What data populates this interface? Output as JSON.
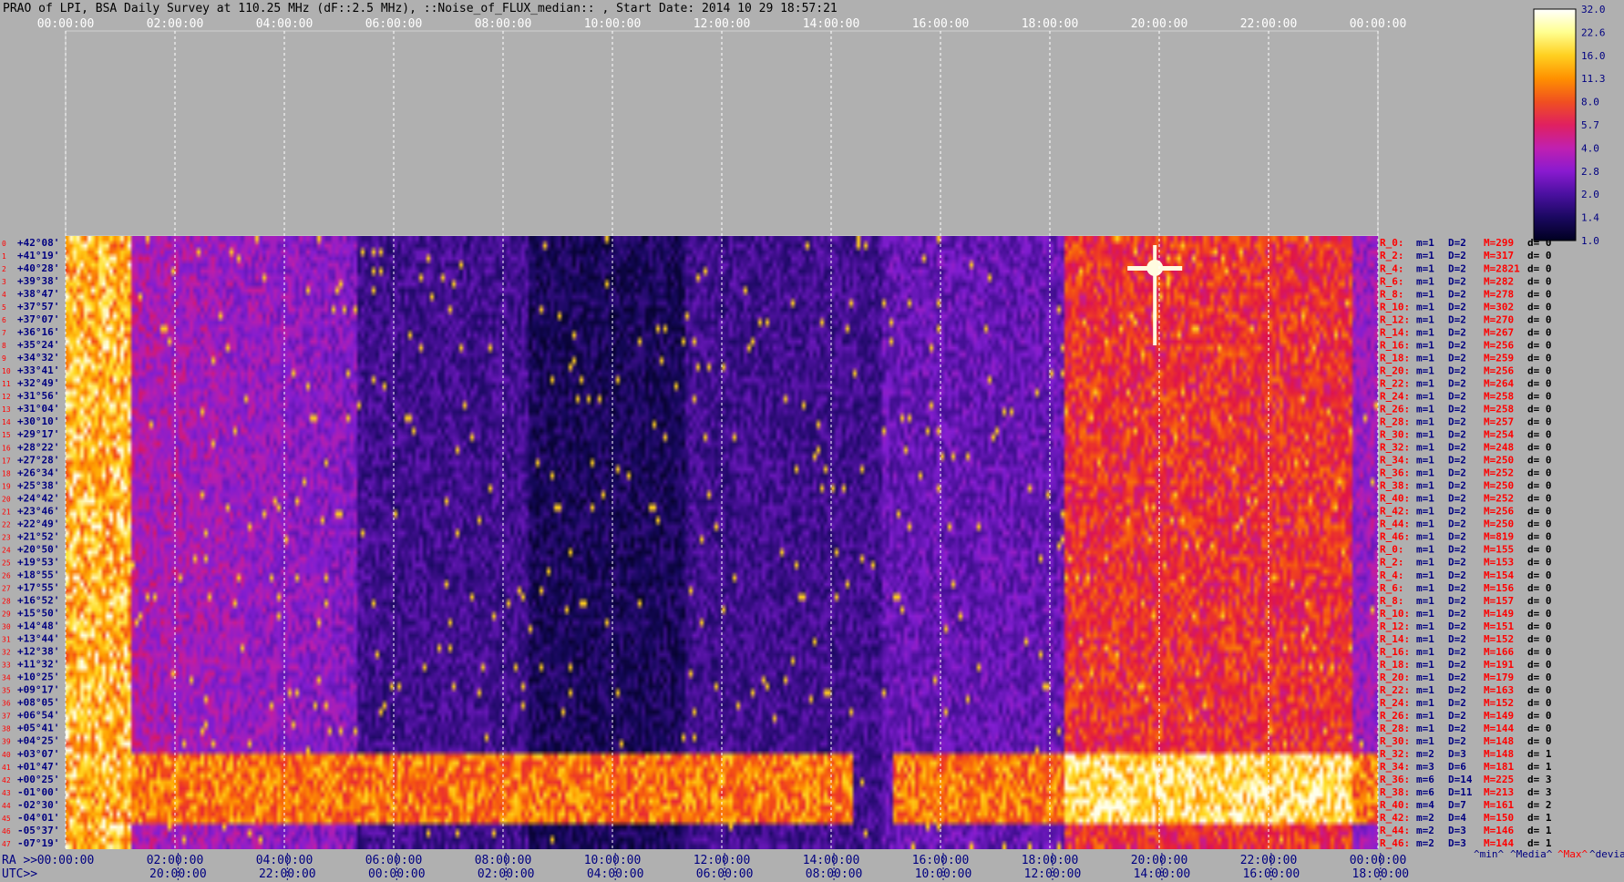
{
  "title": "PRAO of LPI, BSA Daily Survey at 110.25 MHz (dF::2.5 MHz), ::Noise_of_FLUX_median:: , Start Date: 2014 10 29 18:57:21",
  "chart_data": {
    "type": "heatmap",
    "top_axis_ticks": [
      "00:00:00",
      "02:00:00",
      "04:00:00",
      "06:00:00",
      "08:00:00",
      "10:00:00",
      "12:00:00",
      "14:00:00",
      "16:00:00",
      "18:00:00",
      "20:00:00",
      "22:00:00",
      "00:00:00"
    ],
    "ra_label": "RA >>",
    "ra_ticks": [
      "00:00:00",
      "02:00:00",
      "04:00:00",
      "06:00:00",
      "08:00:00",
      "10:00:00",
      "12:00:00",
      "14:00:00",
      "16:00:00",
      "18:00:00",
      "20:00:00",
      "22:00:00",
      "00:00:00"
    ],
    "utc_label": "UTC>>",
    "utc_ticks": [
      "20:00:00",
      "22:00:00",
      "00:00:00",
      "02:00:00",
      "04:00:00",
      "06:00:00",
      "08:00:00",
      "10:00:00",
      "12:00:00",
      "14:00:00",
      "16:00:00",
      "18:00:00"
    ],
    "declinations": [
      "+42°08'",
      "+41°19'",
      "+40°28'",
      "+39°38'",
      "+38°47'",
      "+37°57'",
      "+37°07'",
      "+36°16'",
      "+35°24'",
      "+34°32'",
      "+33°41'",
      "+32°49'",
      "+31°56'",
      "+31°04'",
      "+30°10'",
      "+29°17'",
      "+28°22'",
      "+27°28'",
      "+26°34'",
      "+25°38'",
      "+24°42'",
      "+23°46'",
      "+22°49'",
      "+21°52'",
      "+20°50'",
      "+19°53'",
      "+18°55'",
      "+17°55'",
      "+16°52'",
      "+15°50'",
      "+14°48'",
      "+13°44'",
      "+12°38'",
      "+11°32'",
      "+10°25'",
      "+09°17'",
      "+08°05'",
      "+06°54'",
      "+05°41'",
      "+04°25'",
      "+03°07'",
      "+01°47'",
      "+00°25'",
      "-01°00'",
      "-02°30'",
      "-04°01'",
      "-05°37'",
      "-07°19'"
    ],
    "row_numbers": [
      "0",
      "1",
      "2",
      "3",
      "4",
      "5",
      "6",
      "7",
      "8",
      "9",
      "10",
      "11",
      "12",
      "13",
      "14",
      "15",
      "16",
      "17",
      "18",
      "19",
      "20",
      "21",
      "22",
      "23",
      "24",
      "25",
      "26",
      "27",
      "28",
      "29",
      "30",
      "31",
      "32",
      "33",
      "34",
      "35",
      "36",
      "37",
      "38",
      "39",
      "40",
      "41",
      "42",
      "43",
      "44",
      "45",
      "46",
      "47"
    ],
    "stats_rows": [
      {
        "r": "R_0:",
        "m": "m=1",
        "d": "D=2",
        "M": "M=299",
        "dv": "d= 0"
      },
      {
        "r": "R_2:",
        "m": "m=1",
        "d": "D=2",
        "M": "M=317",
        "dv": "d= 0"
      },
      {
        "r": "R_4:",
        "m": "m=1",
        "d": "D=2",
        "M": "M=2821",
        "dv": "d= 0"
      },
      {
        "r": "R_6:",
        "m": "m=1",
        "d": "D=2",
        "M": "M=282",
        "dv": "d= 0"
      },
      {
        "r": "R_8:",
        "m": "m=1",
        "d": "D=2",
        "M": "M=278",
        "dv": "d= 0"
      },
      {
        "r": "R_10:",
        "m": "m=1",
        "d": "D=2",
        "M": "M=302",
        "dv": "d= 0"
      },
      {
        "r": "R_12:",
        "m": "m=1",
        "d": "D=2",
        "M": "M=270",
        "dv": "d= 0"
      },
      {
        "r": "R_14:",
        "m": "m=1",
        "d": "D=2",
        "M": "M=267",
        "dv": "d= 0"
      },
      {
        "r": "R_16:",
        "m": "m=1",
        "d": "D=2",
        "M": "M=256",
        "dv": "d= 0"
      },
      {
        "r": "R_18:",
        "m": "m=1",
        "d": "D=2",
        "M": "M=259",
        "dv": "d= 0"
      },
      {
        "r": "R_20:",
        "m": "m=1",
        "d": "D=2",
        "M": "M=256",
        "dv": "d= 0"
      },
      {
        "r": "R_22:",
        "m": "m=1",
        "d": "D=2",
        "M": "M=264",
        "dv": "d= 0"
      },
      {
        "r": "R_24:",
        "m": "m=1",
        "d": "D=2",
        "M": "M=258",
        "dv": "d= 0"
      },
      {
        "r": "R_26:",
        "m": "m=1",
        "d": "D=2",
        "M": "M=258",
        "dv": "d= 0"
      },
      {
        "r": "R_28:",
        "m": "m=1",
        "d": "D=2",
        "M": "M=257",
        "dv": "d= 0"
      },
      {
        "r": "R_30:",
        "m": "m=1",
        "d": "D=2",
        "M": "M=254",
        "dv": "d= 0"
      },
      {
        "r": "R_32:",
        "m": "m=1",
        "d": "D=2",
        "M": "M=248",
        "dv": "d= 0"
      },
      {
        "r": "R_34:",
        "m": "m=1",
        "d": "D=2",
        "M": "M=250",
        "dv": "d= 0"
      },
      {
        "r": "R_36:",
        "m": "m=1",
        "d": "D=2",
        "M": "M=252",
        "dv": "d= 0"
      },
      {
        "r": "R_38:",
        "m": "m=1",
        "d": "D=2",
        "M": "M=250",
        "dv": "d= 0"
      },
      {
        "r": "R_40:",
        "m": "m=1",
        "d": "D=2",
        "M": "M=252",
        "dv": "d= 0"
      },
      {
        "r": "R_42:",
        "m": "m=1",
        "d": "D=2",
        "M": "M=256",
        "dv": "d= 0"
      },
      {
        "r": "R_44:",
        "m": "m=1",
        "d": "D=2",
        "M": "M=250",
        "dv": "d= 0"
      },
      {
        "r": "R_46:",
        "m": "m=1",
        "d": "D=2",
        "M": "M=819",
        "dv": "d= 0"
      },
      {
        "r": "R_0:",
        "m": "m=1",
        "d": "D=2",
        "M": "M=155",
        "dv": "d= 0"
      },
      {
        "r": "R_2:",
        "m": "m=1",
        "d": "D=2",
        "M": "M=153",
        "dv": "d= 0"
      },
      {
        "r": "R_4:",
        "m": "m=1",
        "d": "D=2",
        "M": "M=154",
        "dv": "d= 0"
      },
      {
        "r": "R_6:",
        "m": "m=1",
        "d": "D=2",
        "M": "M=156",
        "dv": "d= 0"
      },
      {
        "r": "R_8:",
        "m": "m=1",
        "d": "D=2",
        "M": "M=157",
        "dv": "d= 0"
      },
      {
        "r": "R_10:",
        "m": "m=1",
        "d": "D=2",
        "M": "M=149",
        "dv": "d= 0"
      },
      {
        "r": "R_12:",
        "m": "m=1",
        "d": "D=2",
        "M": "M=151",
        "dv": "d= 0"
      },
      {
        "r": "R_14:",
        "m": "m=1",
        "d": "D=2",
        "M": "M=152",
        "dv": "d= 0"
      },
      {
        "r": "R_16:",
        "m": "m=1",
        "d": "D=2",
        "M": "M=166",
        "dv": "d= 0"
      },
      {
        "r": "R_18:",
        "m": "m=1",
        "d": "D=2",
        "M": "M=191",
        "dv": "d= 0"
      },
      {
        "r": "R_20:",
        "m": "m=1",
        "d": "D=2",
        "M": "M=179",
        "dv": "d= 0"
      },
      {
        "r": "R_22:",
        "m": "m=1",
        "d": "D=2",
        "M": "M=163",
        "dv": "d= 0"
      },
      {
        "r": "R_24:",
        "m": "m=1",
        "d": "D=2",
        "M": "M=152",
        "dv": "d= 0"
      },
      {
        "r": "R_26:",
        "m": "m=1",
        "d": "D=2",
        "M": "M=149",
        "dv": "d= 0"
      },
      {
        "r": "R_28:",
        "m": "m=1",
        "d": "D=2",
        "M": "M=144",
        "dv": "d= 0"
      },
      {
        "r": "R_30:",
        "m": "m=1",
        "d": "D=2",
        "M": "M=148",
        "dv": "d= 0"
      },
      {
        "r": "R_32:",
        "m": "m=2",
        "d": "D=3",
        "M": "M=148",
        "dv": "d= 1"
      },
      {
        "r": "R_34:",
        "m": "m=3",
        "d": "D=6",
        "M": "M=181",
        "dv": "d= 1"
      },
      {
        "r": "R_36:",
        "m": "m=6",
        "d": "D=14",
        "M": "M=225",
        "dv": "d= 3"
      },
      {
        "r": "R_38:",
        "m": "m=6",
        "d": "D=11",
        "M": "M=213",
        "dv": "d= 3"
      },
      {
        "r": "R_40:",
        "m": "m=4",
        "d": "D=7",
        "M": "M=161",
        "dv": "d= 2"
      },
      {
        "r": "R_42:",
        "m": "m=2",
        "d": "D=4",
        "M": "M=150",
        "dv": "d= 1"
      },
      {
        "r": "R_44:",
        "m": "m=2",
        "d": "D=3",
        "M": "M=146",
        "dv": "d= 1"
      },
      {
        "r": "R_46:",
        "m": "m=2",
        "d": "D=3",
        "M": "M=144",
        "dv": "d= 1"
      }
    ],
    "stats_footer": {
      "min": "^min^",
      "median": "^Media^",
      "max": "^Max^",
      "devia": "^devia^"
    },
    "colorbar_ticks": [
      "32.0",
      "22.6",
      "16.0",
      "11.3",
      "8.0",
      "5.7",
      "4.0",
      "2.8",
      "2.0",
      "1.4",
      "1.0"
    ],
    "colorbar_colors": [
      "#000020",
      "#1a0860",
      "#4a10a0",
      "#8a1ad0",
      "#c020b0",
      "#e02060",
      "#f05020",
      "#ff9000",
      "#ffd020",
      "#ffff90",
      "#ffffff"
    ],
    "colors": {
      "background": "#b0b0b0",
      "label_blue": "#000080",
      "label_red": "#ff0000",
      "grid": "#ffffff"
    }
  }
}
